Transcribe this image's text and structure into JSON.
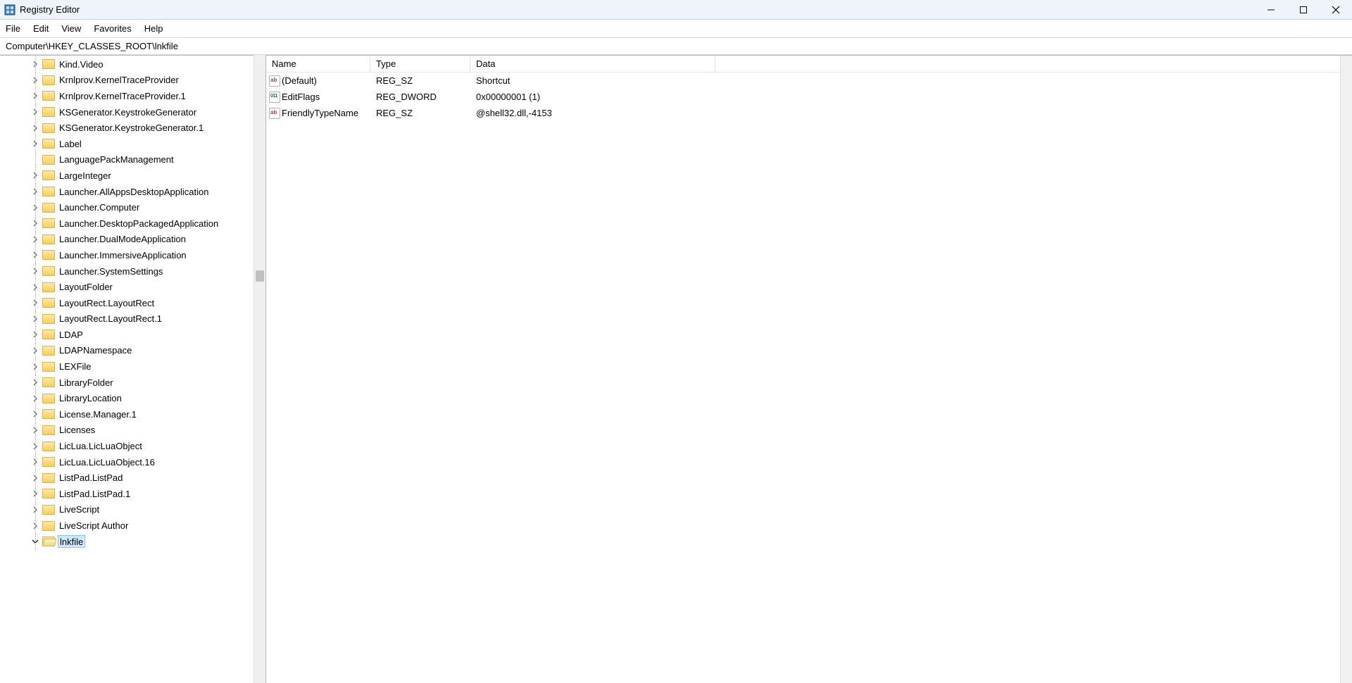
{
  "window": {
    "title": "Registry Editor"
  },
  "menu": {
    "items": [
      "File",
      "Edit",
      "View",
      "Favorites",
      "Help"
    ]
  },
  "address": "Computer\\HKEY_CLASSES_ROOT\\lnkfile",
  "tree": {
    "items": [
      {
        "label": "Kind.Video",
        "expander": "chevron",
        "selected": false
      },
      {
        "label": "Krnlprov.KernelTraceProvider",
        "expander": "chevron",
        "selected": false
      },
      {
        "label": "Krnlprov.KernelTraceProvider.1",
        "expander": "chevron",
        "selected": false
      },
      {
        "label": "KSGenerator.KeystrokeGenerator",
        "expander": "chevron",
        "selected": false
      },
      {
        "label": "KSGenerator.KeystrokeGenerator.1",
        "expander": "chevron",
        "selected": false
      },
      {
        "label": "Label",
        "expander": "chevron",
        "selected": false
      },
      {
        "label": "LanguagePackManagement",
        "expander": "none",
        "selected": false
      },
      {
        "label": "LargeInteger",
        "expander": "chevron",
        "selected": false
      },
      {
        "label": "Launcher.AllAppsDesktopApplication",
        "expander": "chevron",
        "selected": false
      },
      {
        "label": "Launcher.Computer",
        "expander": "chevron",
        "selected": false
      },
      {
        "label": "Launcher.DesktopPackagedApplication",
        "expander": "chevron",
        "selected": false
      },
      {
        "label": "Launcher.DualModeApplication",
        "expander": "chevron",
        "selected": false
      },
      {
        "label": "Launcher.ImmersiveApplication",
        "expander": "chevron",
        "selected": false
      },
      {
        "label": "Launcher.SystemSettings",
        "expander": "chevron",
        "selected": false
      },
      {
        "label": "LayoutFolder",
        "expander": "chevron",
        "selected": false
      },
      {
        "label": "LayoutRect.LayoutRect",
        "expander": "chevron",
        "selected": false
      },
      {
        "label": "LayoutRect.LayoutRect.1",
        "expander": "chevron",
        "selected": false
      },
      {
        "label": "LDAP",
        "expander": "chevron",
        "selected": false
      },
      {
        "label": "LDAPNamespace",
        "expander": "chevron",
        "selected": false
      },
      {
        "label": "LEXFile",
        "expander": "chevron",
        "selected": false
      },
      {
        "label": "LibraryFolder",
        "expander": "chevron",
        "selected": false
      },
      {
        "label": "LibraryLocation",
        "expander": "chevron",
        "selected": false
      },
      {
        "label": "License.Manager.1",
        "expander": "chevron",
        "selected": false
      },
      {
        "label": "Licenses",
        "expander": "chevron",
        "selected": false
      },
      {
        "label": "LicLua.LicLuaObject",
        "expander": "chevron",
        "selected": false
      },
      {
        "label": "LicLua.LicLuaObject.16",
        "expander": "chevron",
        "selected": false
      },
      {
        "label": "ListPad.ListPad",
        "expander": "chevron",
        "selected": false
      },
      {
        "label": "ListPad.ListPad.1",
        "expander": "chevron",
        "selected": false
      },
      {
        "label": "LiveScript",
        "expander": "chevron",
        "selected": false
      },
      {
        "label": "LiveScript Author",
        "expander": "chevron",
        "selected": false
      },
      {
        "label": "lnkfile",
        "expander": "down",
        "selected": true
      }
    ]
  },
  "values": {
    "columns": {
      "name": "Name",
      "type": "Type",
      "data": "Data"
    },
    "rows": [
      {
        "icon": "sz",
        "name": "(Default)",
        "type": "REG_SZ",
        "data": "Shortcut"
      },
      {
        "icon": "dw",
        "name": "EditFlags",
        "type": "REG_DWORD",
        "data": "0x00000001 (1)"
      },
      {
        "icon": "sz",
        "name": "FriendlyTypeName",
        "type": "REG_SZ",
        "data": "@shell32.dll,-4153"
      }
    ]
  }
}
